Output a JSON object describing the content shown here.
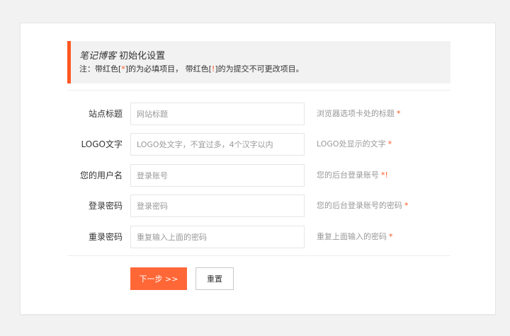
{
  "notice": {
    "brand": "笔记博客",
    "title": "初始化设置",
    "sub_prefix": "注：带红色[",
    "sub_star1": "*",
    "sub_mid": "]的为必填项目， 带红色[",
    "sub_excl": "!",
    "sub_suffix": "]的为提交不可更改项目。"
  },
  "form": {
    "fields": [
      {
        "label": "站点标题",
        "placeholder": "网站标题",
        "value": "",
        "hint": "浏览器选项卡处的标题",
        "mark": "*"
      },
      {
        "label": "LOGO文字",
        "placeholder": "LOGO处文字，不宜过多，4个汉字以内",
        "value": "",
        "hint": "LOGO处显示的文字",
        "mark": "*"
      },
      {
        "label": "您的用户名",
        "placeholder": "登录账号",
        "value": "",
        "hint": "您的后台登录账号",
        "mark": "*!"
      },
      {
        "label": "登录密码",
        "placeholder": "登录密码",
        "value": "",
        "hint": "您的后台登录账号的密码",
        "mark": "*"
      },
      {
        "label": "重录密码",
        "placeholder": "重复输入上面的密码",
        "value": "",
        "hint": "重复上面输入的密码",
        "mark": "*"
      }
    ]
  },
  "buttons": {
    "next": "下一步 >>",
    "reset": "重置"
  },
  "colors": {
    "accent": "#ff5722",
    "notice_bg": "#f2f2f2",
    "border": "#e6e6e6"
  }
}
